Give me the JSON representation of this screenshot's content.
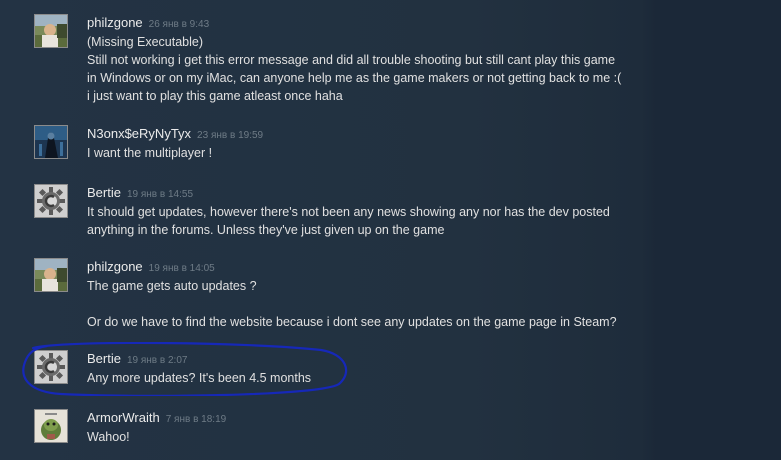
{
  "comments": [
    {
      "author": "philzgone",
      "timestamp": "26 янв в 9:43",
      "text": "(Missing Executable)\nStill not working i get this error message and did all trouble shooting but still cant play this game\nin Windows or on my iMac, can anyone help me as the game makers or not getting back to me :(\ni just want to play this game atleast once haha",
      "avatar": "philzgone-avatar"
    },
    {
      "author": "N3onx$eRyNyTyx",
      "timestamp": "23 янв в 19:59",
      "text": "I want the multiplayer !",
      "avatar": "n3onx-avatar"
    },
    {
      "author": "Bertie",
      "timestamp": "19 янв в 14:55",
      "text": "It should get updates, however there's not been any news showing any nor has the dev posted\nanything in the forums. Unless they've just given up on the game",
      "avatar": "bertie-gear-avatar"
    },
    {
      "author": "philzgone",
      "timestamp": "19 янв в 14:05",
      "text": "The game gets auto updates ?\n\nOr do we have to find the website because i dont see any updates on the game page in Steam?",
      "avatar": "philzgone-avatar"
    },
    {
      "author": "Bertie",
      "timestamp": "19 янв в 2:07",
      "text": "Any more updates? It's been 4.5 months",
      "avatar": "bertie-gear-avatar"
    },
    {
      "author": "ArmorWraith",
      "timestamp": "7 янв в 18:19",
      "text": "Wahoo!",
      "avatar": "armorwraith-avatar"
    }
  ],
  "colors": {
    "background": "#1b2838",
    "author": "#ebebeb",
    "timestamp": "#6e7b86",
    "text": "#e0e0e0",
    "highlight_stroke": "#1628b8"
  }
}
